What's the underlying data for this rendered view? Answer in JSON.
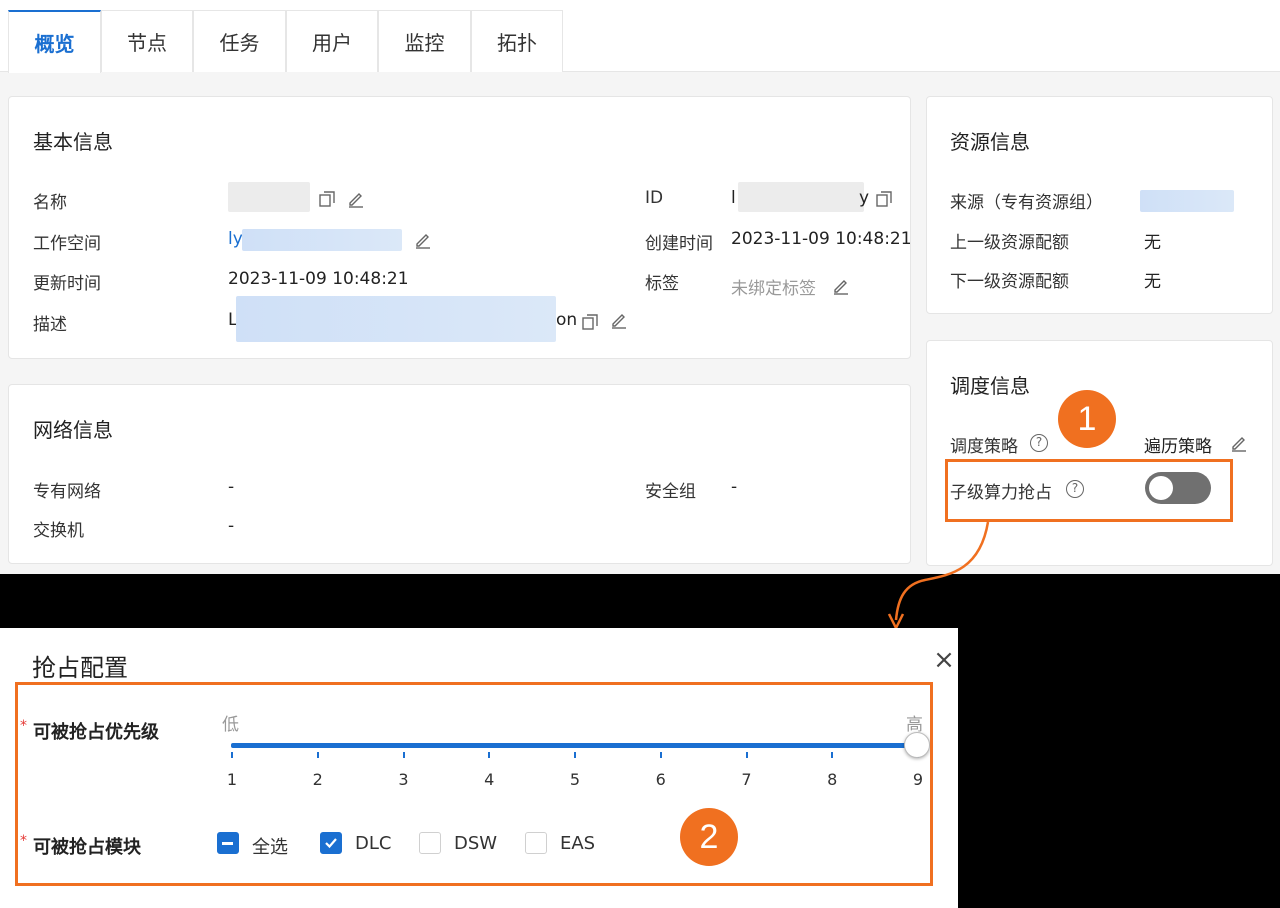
{
  "tabs": [
    "概览",
    "节点",
    "任务",
    "用户",
    "监控",
    "拓扑"
  ],
  "basic_info": {
    "title": "基本信息",
    "name_label": "名称",
    "workspace_label": "工作空间",
    "workspace_value_prefix": "ly",
    "updated_label": "更新时间",
    "updated_value": "2023-11-09 10:48:21",
    "desc_label": "描述",
    "desc_value_prefix": "L",
    "desc_value_suffix": "on",
    "id_label": "ID",
    "id_prefix": "l",
    "id_suffix": "y",
    "created_label": "创建时间",
    "created_value": "2023-11-09 10:48:21",
    "tags_label": "标签",
    "tags_value": "未绑定标签"
  },
  "network_info": {
    "title": "网络信息",
    "vpc_label": "专有网络",
    "vpc_value": "-",
    "switch_label": "交换机",
    "switch_value": "-",
    "sg_label": "安全组",
    "sg_value": "-"
  },
  "resource_info": {
    "title": "资源信息",
    "source_label": "来源（专有资源组）",
    "parent_quota_label": "上一级资源配额",
    "parent_quota_value": "无",
    "child_quota_label": "下一级资源配额",
    "child_quota_value": "无"
  },
  "schedule_info": {
    "title": "调度信息",
    "policy_label": "调度策略",
    "policy_value": "遍历策略",
    "preempt_label": "子级算力抢占",
    "preempt_enabled": false
  },
  "annotations": {
    "badge1": "1",
    "badge2": "2"
  },
  "dialog": {
    "title": "抢占配置",
    "close": "×",
    "required_mark": "*",
    "priority_label": "可被抢占优先级",
    "low": "低",
    "high": "高",
    "ticks": [
      "1",
      "2",
      "3",
      "4",
      "5",
      "6",
      "7",
      "8",
      "9"
    ],
    "priority_value": 9,
    "module_label": "可被抢占模块",
    "modules": [
      {
        "label": "全选",
        "state": "indeterminate"
      },
      {
        "label": "DLC",
        "state": "checked"
      },
      {
        "label": "DSW",
        "state": "unchecked"
      },
      {
        "label": "EAS",
        "state": "unchecked"
      }
    ]
  },
  "colors": {
    "accent": "#1a6fd1",
    "highlight": "#f07020"
  }
}
